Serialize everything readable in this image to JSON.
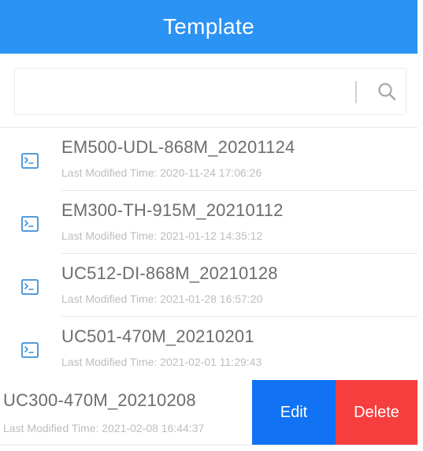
{
  "header": {
    "title": "Template"
  },
  "search": {
    "value": "",
    "placeholder": "",
    "icon": "search-icon"
  },
  "templates": [
    {
      "name": "EM500-UDL-868M_20201124",
      "modified": "Last Modified Time: 2020-11-24 17:06:26",
      "icon": "terminal-icon"
    },
    {
      "name": "EM300-TH-915M_20210112",
      "modified": "Last Modified Time: 2021-01-12 14:35:12",
      "icon": "terminal-icon"
    },
    {
      "name": "UC512-DI-868M_20210128",
      "modified": "Last Modified Time: 2021-01-28 16:57:20",
      "icon": "terminal-icon"
    },
    {
      "name": "UC501-470M_20210201",
      "modified": "Last Modified Time: 2021-02-01 11:29:43",
      "icon": "terminal-icon"
    }
  ],
  "swiped": {
    "name": "UC300-470M_20210208",
    "modified": "Last Modified Time: 2021-02-08 16:44:37",
    "edit_label": "Edit",
    "delete_label": "Delete"
  },
  "colors": {
    "header": "#2b93f3",
    "edit": "#1172f4",
    "delete": "#f63e3e",
    "icon": "#3d8fd8"
  }
}
